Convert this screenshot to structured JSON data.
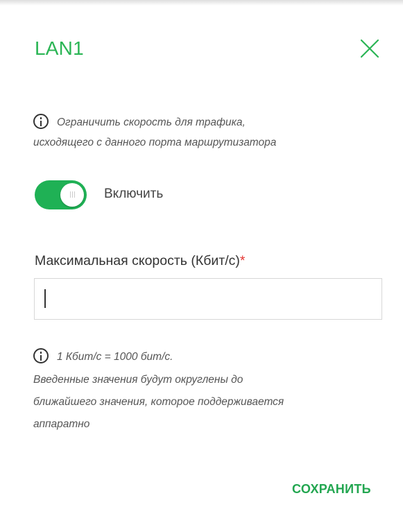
{
  "dialog": {
    "title": "LAN1",
    "close_icon": "close-icon",
    "accent_color": "#2bb555"
  },
  "info": {
    "icon": "info-icon",
    "line1": "Ограничить скорость для трафика,",
    "line2": "исходящего с данного порта маршрутизатора"
  },
  "toggle": {
    "label": "Включить",
    "state": "on",
    "color": "#1fb155"
  },
  "speed_field": {
    "label": "Максимальная скорость (Кбит/с)",
    "required_mark": "*",
    "value": ""
  },
  "note": {
    "icon": "info-icon",
    "line1": "1 Кбит/с = 1000 бит/с.",
    "line2": "Введенные значения будут округлены до",
    "line3": "ближайшего значения, которое поддерживается",
    "line4": "аппаратно"
  },
  "actions": {
    "save_label": "СОХРАНИТЬ"
  }
}
